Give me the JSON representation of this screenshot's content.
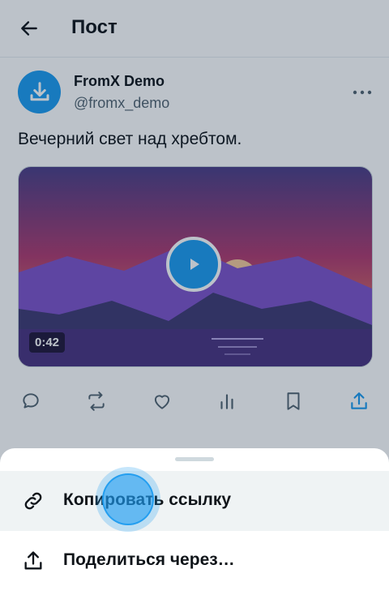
{
  "header": {
    "title": "Пост",
    "back_icon": "arrow-left-icon"
  },
  "post": {
    "author_name": "FromX Demo",
    "author_handle": "@fromx_demo",
    "text": "Вечерний свет над хребтом.",
    "video": {
      "duration": "0:42",
      "play_icon": "play-icon"
    },
    "actions": [
      "reply-icon",
      "repost-icon",
      "like-icon",
      "views-icon",
      "bookmark-icon",
      "share-icon"
    ]
  },
  "sheet": {
    "items": [
      {
        "label": "Копировать ссылку",
        "icon": "link-icon"
      },
      {
        "label": "Поделиться через…",
        "icon": "share-icon"
      }
    ]
  },
  "colors": {
    "accent": "#1d9bf0",
    "text": "#0f1419",
    "muted": "#536471"
  }
}
